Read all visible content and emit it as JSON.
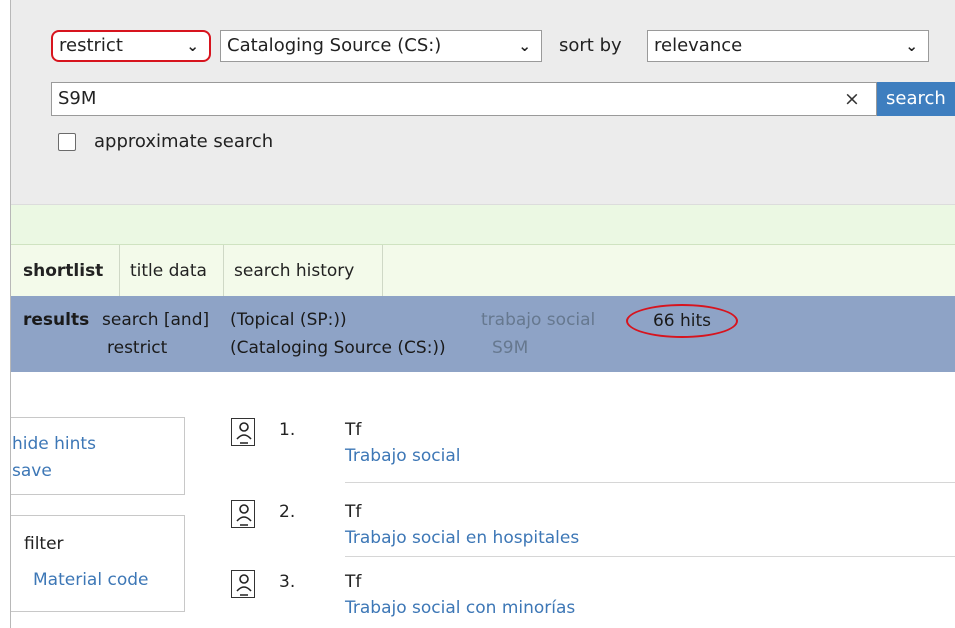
{
  "search_panel": {
    "restrict_select": "restrict",
    "index_select": "Cataloging Source (CS:)",
    "sort_label": "sort by",
    "sort_select": "relevance",
    "search_value": "S9M",
    "clear_symbol": "×",
    "search_button": "search",
    "approximate_label": "approximate search",
    "approximate_checked": false
  },
  "tabs": [
    {
      "label": "shortlist",
      "active": true
    },
    {
      "label": "title data",
      "active": false
    },
    {
      "label": "search history",
      "active": false
    }
  ],
  "results_summary": {
    "label": "results",
    "rows": [
      {
        "operator": "search [and]",
        "index": "(Topical (SP:))",
        "term": "trabajo social"
      },
      {
        "operator": "restrict",
        "index": "(Cataloging Source (CS:))",
        "term": "S9M"
      }
    ],
    "hits": "66 hits"
  },
  "hints": {
    "hide_hints": "hide hints",
    "save": "save"
  },
  "filter": {
    "label": "filter",
    "material_code": "Material code"
  },
  "results": [
    {
      "number": "1.",
      "type": "Tf",
      "title": "Trabajo social",
      "icon": "thesaurus-record-icon"
    },
    {
      "number": "2.",
      "type": "Tf",
      "title": "Trabajo social en hospitales",
      "icon": "thesaurus-record-icon"
    },
    {
      "number": "3.",
      "type": "Tf",
      "title": "Trabajo social con minorías",
      "icon": "thesaurus-record-icon"
    }
  ],
  "colors": {
    "accent_red": "#d7141e",
    "link_blue": "#3d77b6",
    "search_button_blue": "#3e7ebf",
    "results_band": "#8ea3c6",
    "green_band": "#ebf8e3"
  }
}
